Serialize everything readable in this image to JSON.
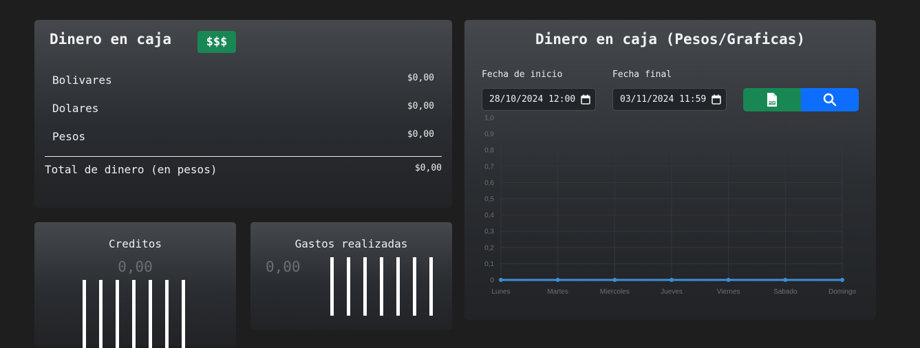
{
  "caja": {
    "title": "Dinero en caja",
    "badge": "$$$",
    "rows": [
      {
        "label": "Bolivares",
        "value": "$0,00"
      },
      {
        "label": "Dolares",
        "value": "$0,00"
      },
      {
        "label": "Pesos",
        "value": "$0,00"
      }
    ],
    "total_label": "Total de dinero (en pesos)",
    "total_value": "$0,00"
  },
  "grafica": {
    "title": "Dinero en caja (Pesos/Graficas)",
    "start_label": "Fecha de inicio",
    "start_value": "28/10/2024 12:00",
    "end_label": "Fecha final",
    "end_value": "03/11/2024 11:59",
    "pdf_icon": "pdf-file-icon",
    "search_icon": "search-icon",
    "pdf_color": "#198754",
    "search_color": "#0d6efd"
  },
  "chart_data": {
    "type": "line",
    "categories": [
      "Lunes",
      "Martes",
      "Miercoles",
      "Jueves",
      "Viernes",
      "Sabado",
      "Domingo"
    ],
    "series": [
      {
        "values": [
          0,
          0,
          0,
          0,
          0,
          0,
          0
        ],
        "color": "#3a8fd9"
      }
    ],
    "yticks": [
      "0",
      "0,1",
      "0,2",
      "0,3",
      "0,4",
      "0,5",
      "0,6",
      "0,7",
      "0,8",
      "0,9",
      "1,0"
    ],
    "ylim": [
      0,
      1
    ],
    "grid": true
  },
  "creditos": {
    "title": "Creditos",
    "value": "0,00"
  },
  "gastos": {
    "title": "Gastos realizadas",
    "value": "0,00"
  }
}
